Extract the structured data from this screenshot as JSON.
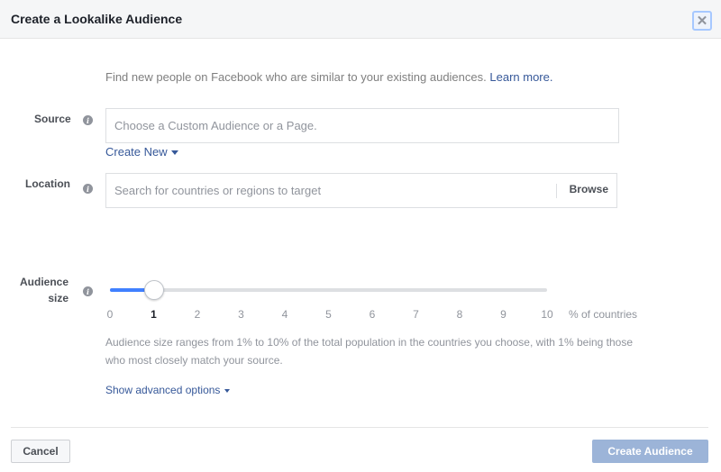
{
  "dialog": {
    "title": "Create a Lookalike Audience",
    "close_icon": "close-icon"
  },
  "intro": {
    "text": "Find new people on Facebook who are similar to your existing audiences.",
    "link": "Learn more."
  },
  "source": {
    "label": "Source",
    "info_icon": "info-icon",
    "placeholder": "Choose a Custom Audience or a Page.",
    "value": "",
    "create_new": "Create New"
  },
  "location": {
    "label": "Location",
    "info_icon": "info-icon",
    "placeholder": "Search for countries or regions to target",
    "value": "",
    "browse": "Browse"
  },
  "audience_size": {
    "label_line1": "Audience",
    "label_line2": "size",
    "info_icon": "info-icon",
    "min": 0,
    "max": 10,
    "value": 1,
    "ticks": [
      "0",
      "1",
      "2",
      "3",
      "4",
      "5",
      "6",
      "7",
      "8",
      "9",
      "10"
    ],
    "unit": "% of countries",
    "description": "Audience size ranges from 1% to 10% of the total population in the countries you choose, with 1% being those who most closely match your source.",
    "slider_color": "#4080ff"
  },
  "advanced": {
    "label": "Show advanced options"
  },
  "footer": {
    "cancel": "Cancel",
    "create": "Create Audience",
    "create_enabled": false
  }
}
